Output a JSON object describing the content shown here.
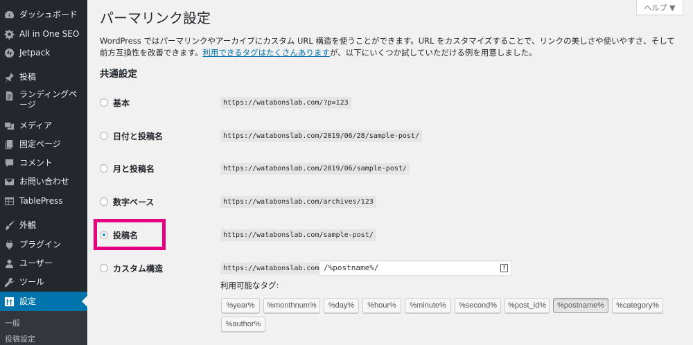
{
  "sidebar": {
    "items": [
      {
        "label": "ダッシュボード",
        "icon": "dashboard-icon"
      },
      {
        "label": "All in One SEO",
        "icon": "gear-icon"
      },
      {
        "label": "Jetpack",
        "icon": "jetpack-icon"
      },
      {
        "label": "投稿",
        "icon": "pin-icon"
      },
      {
        "label": "ランディングページ",
        "icon": "landing-page-icon"
      },
      {
        "label": "メディア",
        "icon": "media-icon"
      },
      {
        "label": "固定ページ",
        "icon": "page-icon"
      },
      {
        "label": "コメント",
        "icon": "comment-icon"
      },
      {
        "label": "お問い合わせ",
        "icon": "mail-icon"
      },
      {
        "label": "TablePress",
        "icon": "table-icon"
      },
      {
        "label": "外観",
        "icon": "brush-icon"
      },
      {
        "label": "プラグイン",
        "icon": "plugin-icon"
      },
      {
        "label": "ユーザー",
        "icon": "user-icon"
      },
      {
        "label": "ツール",
        "icon": "wrench-icon"
      },
      {
        "label": "設定",
        "icon": "settings-icon"
      }
    ],
    "active": "設定",
    "submenu": [
      "一般",
      "投稿設定"
    ]
  },
  "header": {
    "title": "パーマリンク設定",
    "help": "ヘルプ ▼"
  },
  "intro": {
    "text1": "WordPress ではパーマリンクやアーカイブにカスタム URL 構造を使うことができます。URL をカスタマイズすることで、リンクの美しさや使いやすさ、そして前方互換性を改善できます。",
    "link": "利用できるタグはたくさんあります",
    "text2": "が、以下にいくつか試していただける例を用意しました。"
  },
  "section_title": "共通設定",
  "options": [
    {
      "label": "基本",
      "example": "https://watabonslab.com/?p=123",
      "checked": false
    },
    {
      "label": "日付と投稿名",
      "example": "https://watabonslab.com/2019/06/28/sample-post/",
      "checked": false
    },
    {
      "label": "月と投稿名",
      "example": "https://watabonslab.com/2019/06/sample-post/",
      "checked": false
    },
    {
      "label": "数字ベース",
      "example": "https://watabonslab.com/archives/123",
      "checked": false
    },
    {
      "label": "投稿名",
      "example": "https://watabonslab.com/sample-post/",
      "checked": true
    },
    {
      "label": "カスタム構造",
      "example": "https://watabonslab.com",
      "checked": false
    }
  ],
  "custom_structure": {
    "value": "/%postname%/",
    "tags_label": "利用可能なタグ:",
    "tags": [
      "%year%",
      "%monthnum%",
      "%day%",
      "%hour%",
      "%minute%",
      "%second%",
      "%post_id%",
      "%postname%",
      "%category%",
      "%author%"
    ],
    "pressed_tag": "%postname%"
  },
  "colors": {
    "sidebar_bg": "#23282d",
    "active_bg": "#0073aa",
    "highlight": "#e4007f",
    "link": "#0073aa"
  }
}
